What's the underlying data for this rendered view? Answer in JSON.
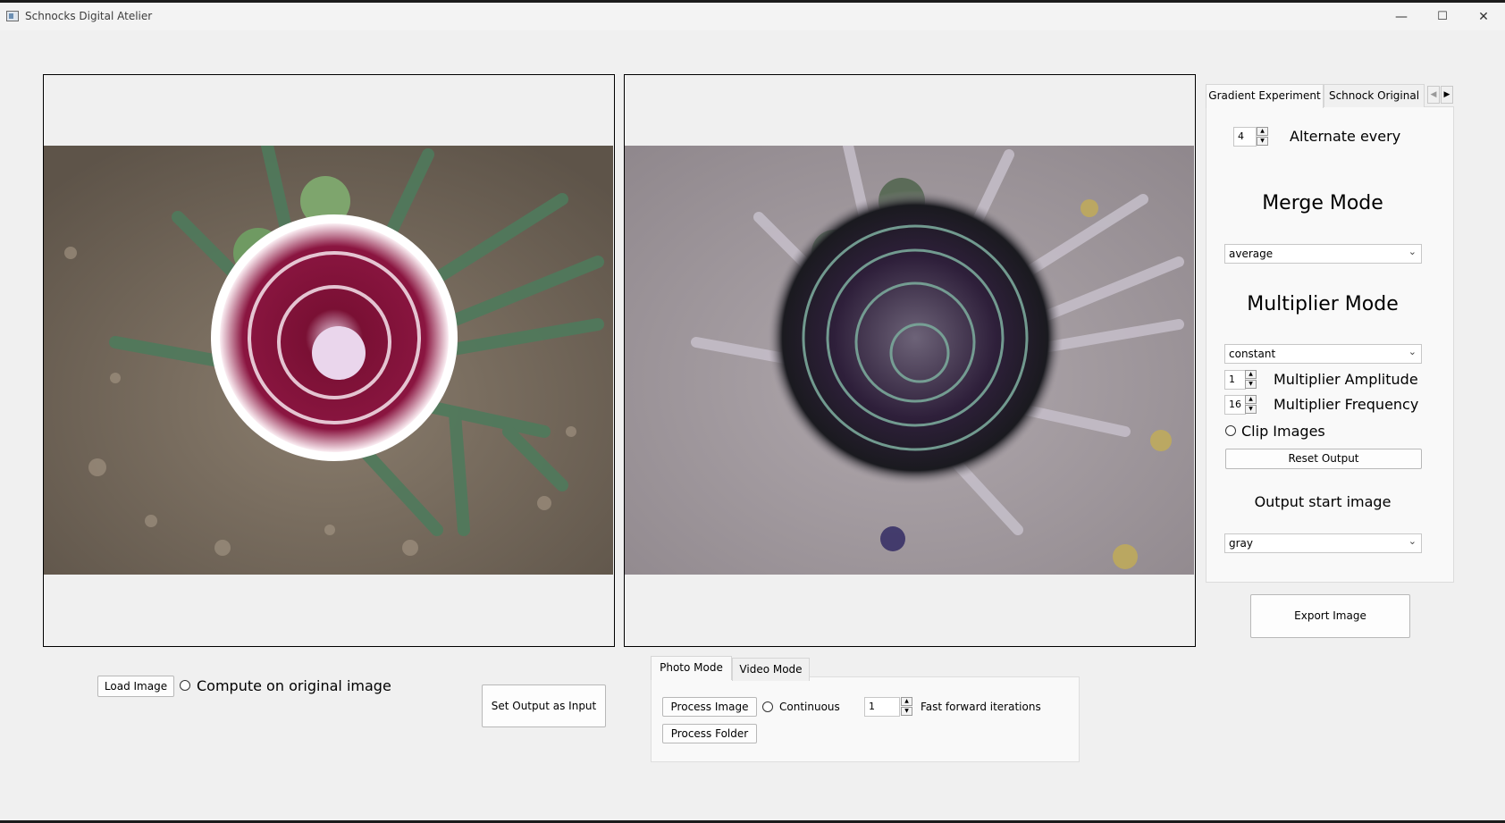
{
  "window": {
    "title": "Schnocks Digital Atelier"
  },
  "title_controls": {
    "minimize": "—",
    "maximize": "☐",
    "close": "✕"
  },
  "colors": {
    "bg": "#f0f0f0",
    "panel": "#f9f9f9"
  },
  "right_tabs": {
    "tabs": [
      "Gradient Experiment",
      "Schnock Original"
    ],
    "scroll_left": "◀",
    "scroll_right": "▶"
  },
  "gradient": {
    "alternate_value": "4",
    "alternate_label": "Alternate every",
    "merge_heading": "Merge Mode",
    "merge_value": "average",
    "multiplier_heading": "Multiplier Mode",
    "multiplier_value": "constant",
    "amplitude_value": "1",
    "amplitude_label": "Multiplier Amplitude",
    "frequency_value": "16",
    "frequency_label": "Multiplier Frequency",
    "clip_label": "Clip Images",
    "reset_label": "Reset Output",
    "start_heading": "Output start image",
    "start_value": "gray"
  },
  "export_label": "Export Image",
  "bottom_left": {
    "load_label": "Load Image",
    "compute_label": "Compute on original image",
    "set_output_label": "Set Output as Input"
  },
  "mode_tabs": {
    "tabs": [
      "Photo Mode",
      "Video Mode"
    ]
  },
  "photo_mode": {
    "process_image_label": "Process Image",
    "continuous_label": "Continuous",
    "iterations_value": "1",
    "iterations_label": "Fast forward iterations",
    "process_folder_label": "Process Folder"
  },
  "spin_glyphs": {
    "up": "▲",
    "down": "▼"
  },
  "combo_chevron": "⌄"
}
